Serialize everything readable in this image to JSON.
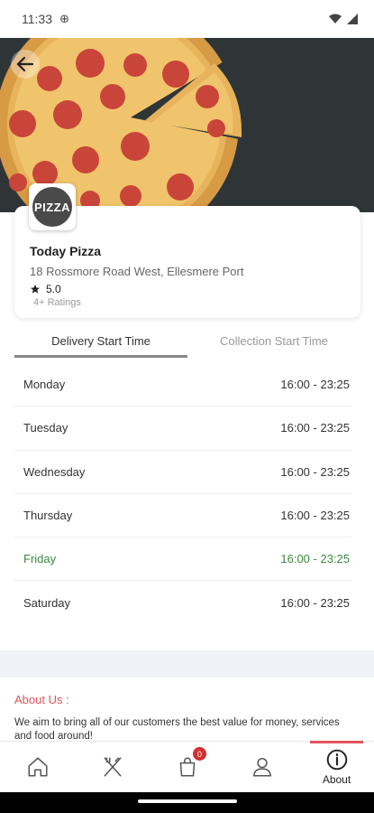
{
  "status_bar": {
    "time": "11:33"
  },
  "restaurant": {
    "logo_text": "PIZZA",
    "name": "Today Pizza",
    "address": "18 Rossmore Road West, Ellesmere Port",
    "rating": "5.0",
    "ratings_count": "4+ Ratings"
  },
  "tabs": [
    {
      "label": "Delivery Start Time",
      "active": true
    },
    {
      "label": "Collection Start Time",
      "active": false
    }
  ],
  "schedule": [
    {
      "day": "Monday",
      "hours": "16:00 - 23:25"
    },
    {
      "day": "Tuesday",
      "hours": "16:00 - 23:25"
    },
    {
      "day": "Wednesday",
      "hours": "16:00 - 23:25"
    },
    {
      "day": "Thursday",
      "hours": "16:00 - 23:25"
    },
    {
      "day": "Friday",
      "hours": "16:00 - 23:25",
      "today": true
    },
    {
      "day": "Saturday",
      "hours": "16:00 - 23:25"
    }
  ],
  "about": {
    "title": "About Us :",
    "text": "We aim to bring all of our customers the best value for money, services and food around!"
  },
  "bottom_nav": {
    "cart_badge": "0",
    "about_label": "About"
  },
  "colors": {
    "accent": "#e0565b",
    "today": "#3a8a3f",
    "badge": "#d32f2f"
  }
}
